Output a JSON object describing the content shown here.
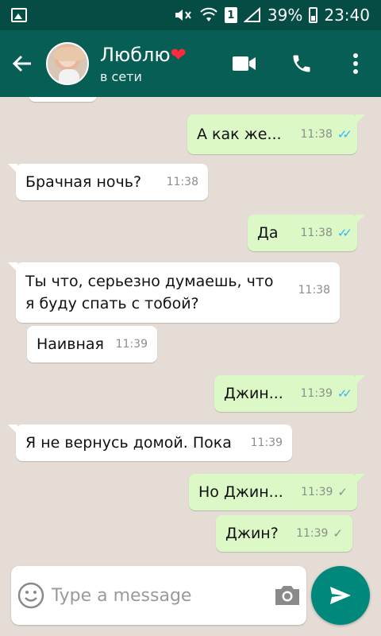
{
  "status_bar": {
    "battery": "39%",
    "sim": "1",
    "time": "23:40"
  },
  "header": {
    "contact_name": "Люблю",
    "contact_status": "в сети"
  },
  "messages": [
    {
      "direction": "out",
      "text": "А как же...",
      "time": "11:38",
      "status": "read"
    },
    {
      "direction": "in",
      "text": "Брачная ночь?",
      "time": "11:38"
    },
    {
      "direction": "out",
      "text": "Да",
      "time": "11:38",
      "status": "read"
    },
    {
      "direction": "in",
      "text": "Ты что, серьезно думаешь, что я буду спать с тобой?",
      "time": "11:38"
    },
    {
      "direction": "in",
      "text": "Наивная",
      "time": "11:39"
    },
    {
      "direction": "out",
      "text": "Джин...",
      "time": "11:39",
      "status": "read"
    },
    {
      "direction": "in",
      "text": "Я не вернусь домой. Пока",
      "time": "11:39"
    },
    {
      "direction": "out",
      "text": "Но Джин...",
      "time": "11:39",
      "status": "sent"
    },
    {
      "direction": "out",
      "text": "Джин?",
      "time": "11:39",
      "status": "sent"
    }
  ],
  "composer": {
    "placeholder": "Type a message"
  },
  "colors": {
    "header": "#075e54",
    "status_bar": "#054d44",
    "outgoing_bubble": "#dcf8c6",
    "incoming_bubble": "#ffffff",
    "send_button": "#00897b",
    "read_check": "#34b7f1"
  }
}
